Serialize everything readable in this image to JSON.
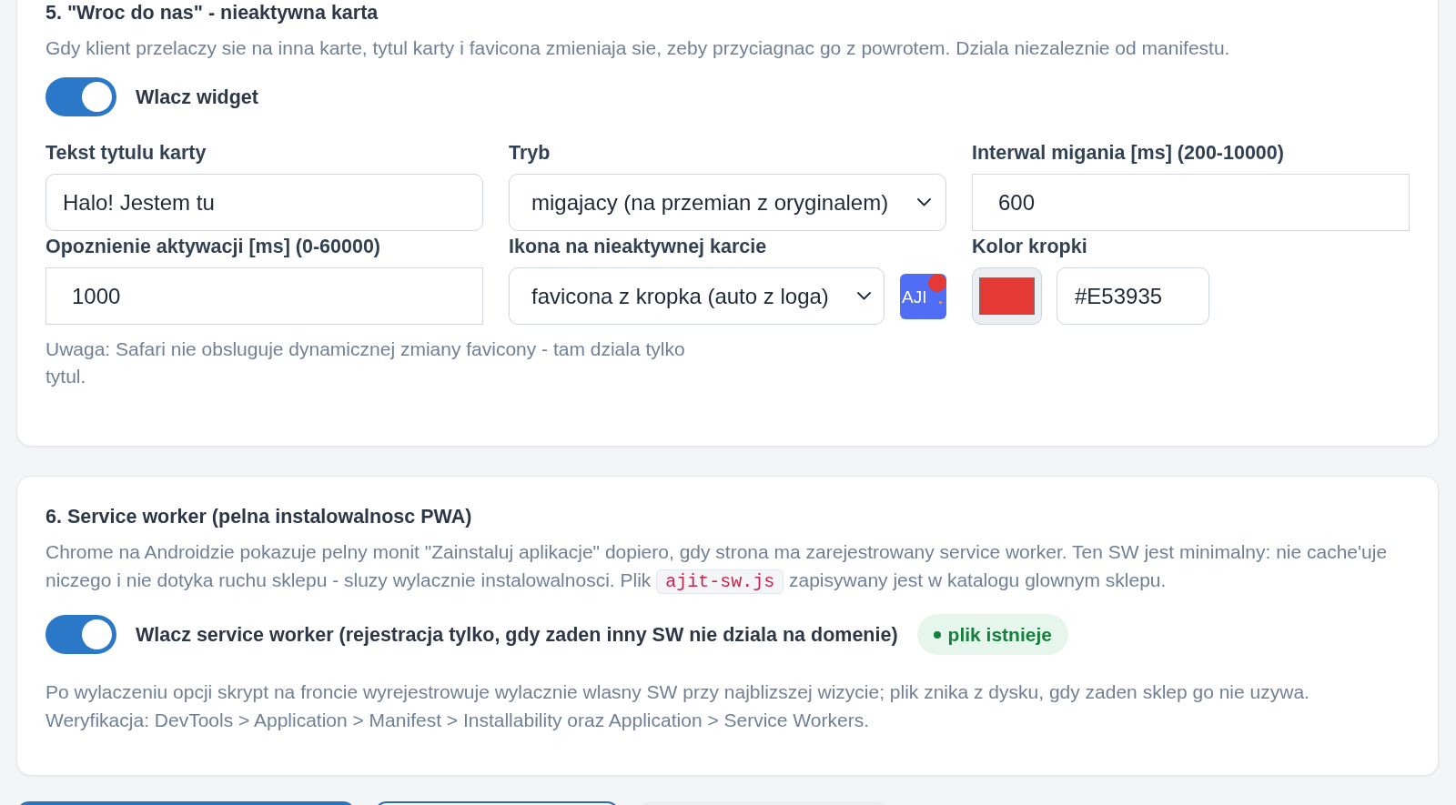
{
  "sections": [
    {
      "title": "5. \"Wroc do nas\" - nieaktywna karta",
      "description": [
        {
          "kind": "text",
          "text": "Gdy klient przelaczy sie na inna karte, tytul karty i favicona zmieniaja sie, zeby przyciagnac go z powrotem. Dziala niezaleznie od manifestu."
        }
      ],
      "toggle": {
        "label": "Wlacz widget",
        "on": true
      },
      "fields": [
        {
          "kind": "text",
          "label": "Tekst tytulu karty",
          "value": "Halo! Jestem tu"
        },
        {
          "kind": "select",
          "label": "Tryb",
          "value": "migajacy (na przemian z oryginalem)"
        },
        {
          "kind": "number",
          "label": "Interwal migania [ms] (200-10000)",
          "value": "600"
        },
        {
          "kind": "number",
          "label": "Opoznienie aktywacji [ms] (0-60000)",
          "value": "1000"
        },
        {
          "kind": "select_preview",
          "label": "Ikona na nieaktywnej karcie",
          "value": "favicona z kropka (auto z loga)",
          "preview_text": "AJI"
        },
        {
          "kind": "color",
          "label": "Kolor kropki",
          "value": "#E53935"
        }
      ],
      "note": [
        "Uwaga: Safari nie obsluguje dynamicznej zmiany favicony - tam dziala tylko tytul."
      ]
    },
    {
      "title": "6. Service worker (pelna instalowalnosc PWA)",
      "description": [
        {
          "kind": "text",
          "text": "Chrome na Androidzie pokazuje pelny monit \"Zainstaluj aplikacje\" dopiero, gdy strona ma zarejestrowany service worker. Ten SW jest minimalny: nie cache'uje niczego i nie dotyka ruchu sklepu - sluzy wylacznie instalowalnosci. Plik "
        },
        {
          "kind": "code",
          "text": "ajit-sw.js"
        },
        {
          "kind": "text",
          "text": " zapisywany jest w katalogu glownym sklepu."
        }
      ],
      "toggle": {
        "label": "Wlacz service worker (rejestracja tylko, gdy zaden inny SW nie dziala na domenie)",
        "on": true
      },
      "badge": {
        "kind": "success",
        "label": "plik istnieje"
      },
      "note": [
        "Po wylaczeniu opcji skrypt na froncie wyrejestrowuje wylacznie wlasny SW przy najblizszej wizycie; plik znika z dysku, gdy zaden sklep go nie uzywa.",
        "Weryfikacja: DevTools > Application > Manifest > Installability oraz Application > Service Workers."
      ]
    }
  ],
  "actions": [
    {
      "kind": "primary"
    },
    {
      "kind": "outline"
    },
    {
      "kind": "secondary"
    }
  ]
}
